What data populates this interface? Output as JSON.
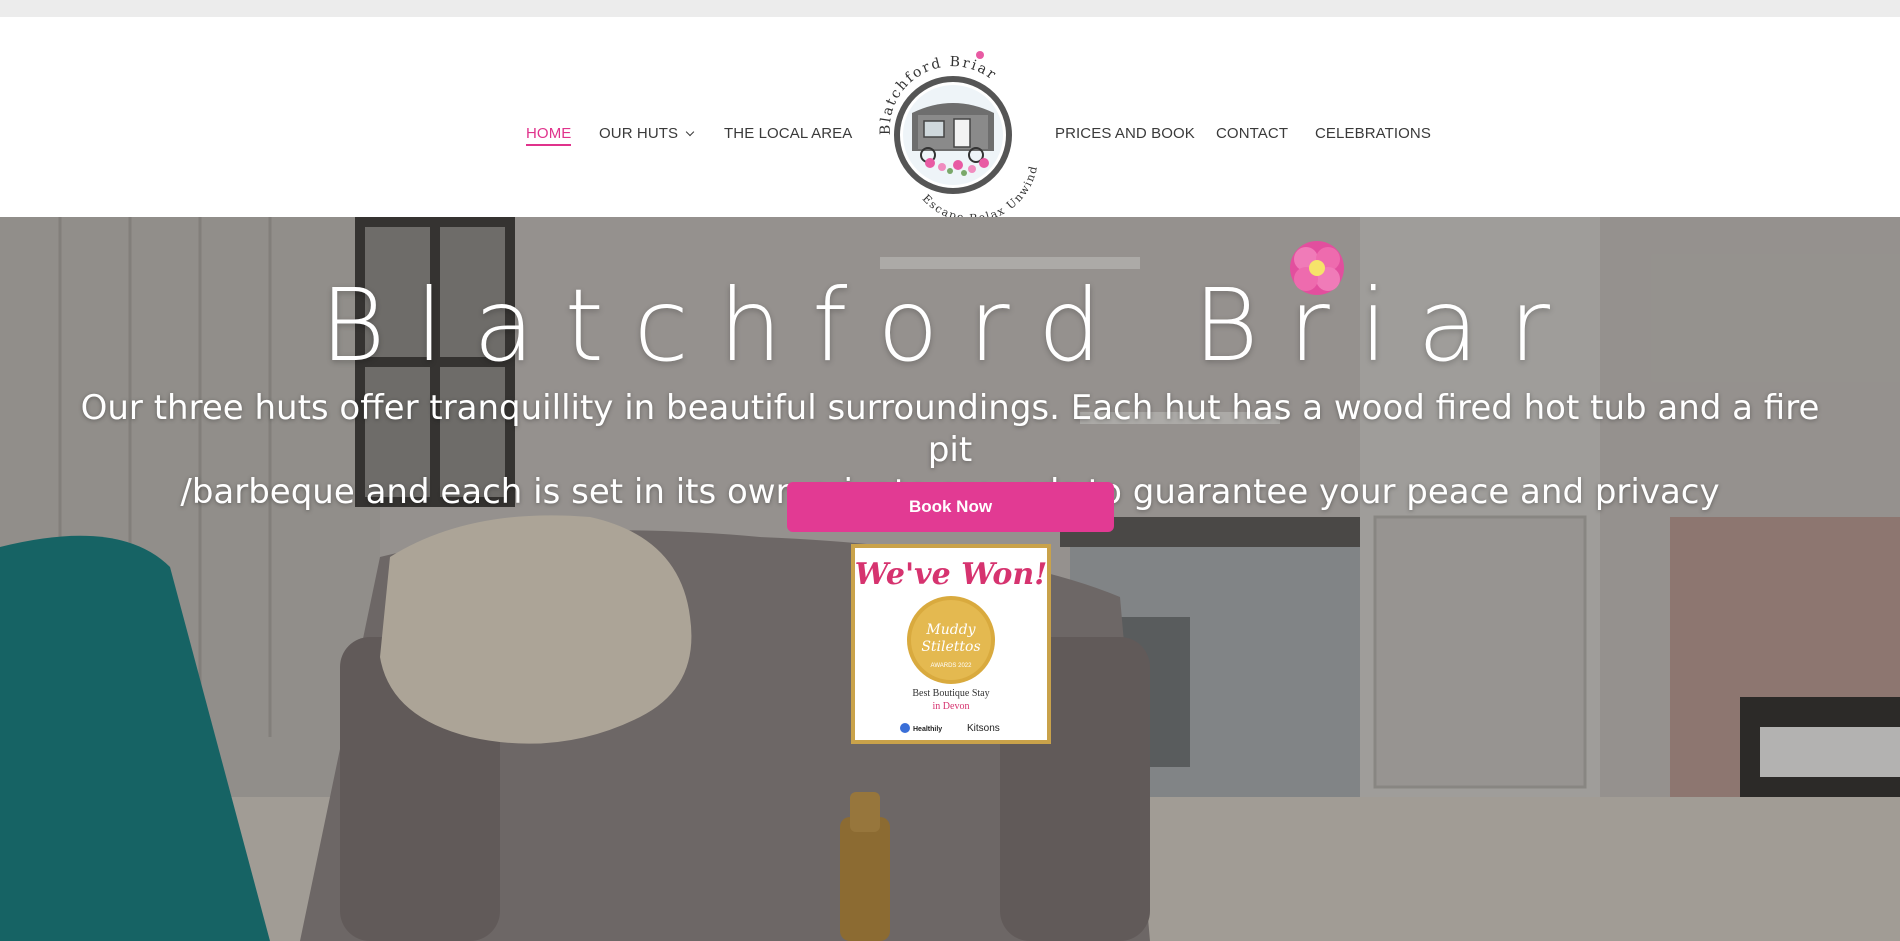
{
  "nav": {
    "home": "HOME",
    "our_huts": "OUR HUTS",
    "local_area": "THE LOCAL AREA",
    "prices_book": "PRICES AND BOOK",
    "contact": "CONTACT",
    "celebrations": "CELEBRATIONS"
  },
  "logo": {
    "top_text": "Blatchford Briar",
    "bottom_text": "Escape Relax Unwind"
  },
  "hero": {
    "title": "Blatchford Briar",
    "subtitle_line1": "Our three huts offer tranquillity in beautiful surroundings. Each hut has a wood fired hot tub and a fire pit",
    "subtitle_line2": "/barbeque and each is set in its own private grounds to guarantee your peace and privacy",
    "button": "Book Now"
  },
  "award": {
    "headline": "We've Won!",
    "medal_line1": "Muddy",
    "medal_line2": "Stilettos",
    "medal_line3": "AWARDS 2022",
    "category": "Best Boutique Stay",
    "region": "in Devon",
    "sponsor1": "Healthily",
    "sponsor2": "Kitsons"
  },
  "colors": {
    "accent": "#e23a93",
    "nav_text": "#3a3a3a",
    "gold": "#c9a24a"
  }
}
